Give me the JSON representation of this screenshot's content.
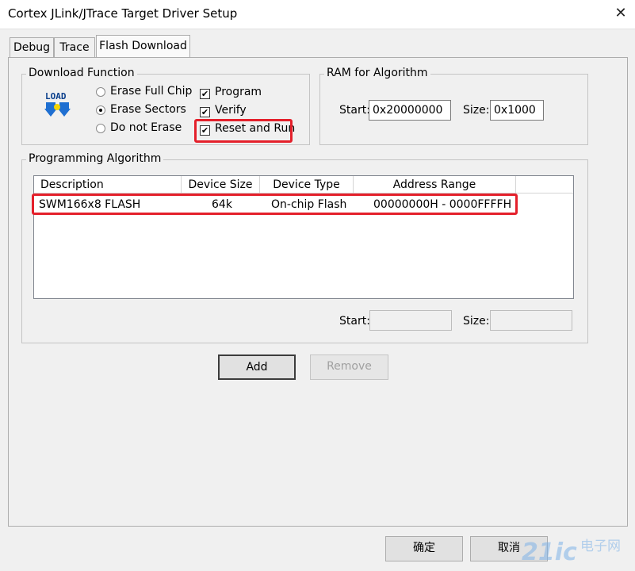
{
  "window": {
    "title": "Cortex JLink/JTrace Target Driver Setup",
    "close_glyph": "✕"
  },
  "tabs": [
    {
      "label": "Debug"
    },
    {
      "label": "Trace"
    },
    {
      "label": "Flash Download"
    }
  ],
  "download_function": {
    "legend": "Download Function",
    "icon_text": "LOAD",
    "radios": [
      {
        "label": "Erase Full Chip",
        "selected": false
      },
      {
        "label": "Erase Sectors",
        "selected": true
      },
      {
        "label": "Do not Erase",
        "selected": false
      }
    ],
    "checks": [
      {
        "label": "Program",
        "checked": true
      },
      {
        "label": "Verify",
        "checked": true
      },
      {
        "label": "Reset and Run",
        "checked": true
      }
    ]
  },
  "ram": {
    "legend": "RAM for Algorithm",
    "start_label": "Start:",
    "start_value": "0x20000000",
    "size_label": "Size:",
    "size_value": "0x1000"
  },
  "programming_algorithm": {
    "legend": "Programming Algorithm",
    "columns": [
      "Description",
      "Device Size",
      "Device Type",
      "Address Range"
    ],
    "rows": [
      {
        "description": "SWM166x8 FLASH",
        "size": "64k",
        "type": "On-chip Flash",
        "range": "00000000H - 0000FFFFH"
      }
    ],
    "start_label": "Start:",
    "start_value": "",
    "size_label": "Size:",
    "size_value": ""
  },
  "buttons": {
    "add": "Add",
    "remove": "Remove",
    "ok": "确定",
    "cancel": "取消"
  },
  "watermark": {
    "number": "21ic",
    "cn": "电子网"
  },
  "colors": {
    "highlight": "#e4202b",
    "accent": "#0a64c8"
  }
}
